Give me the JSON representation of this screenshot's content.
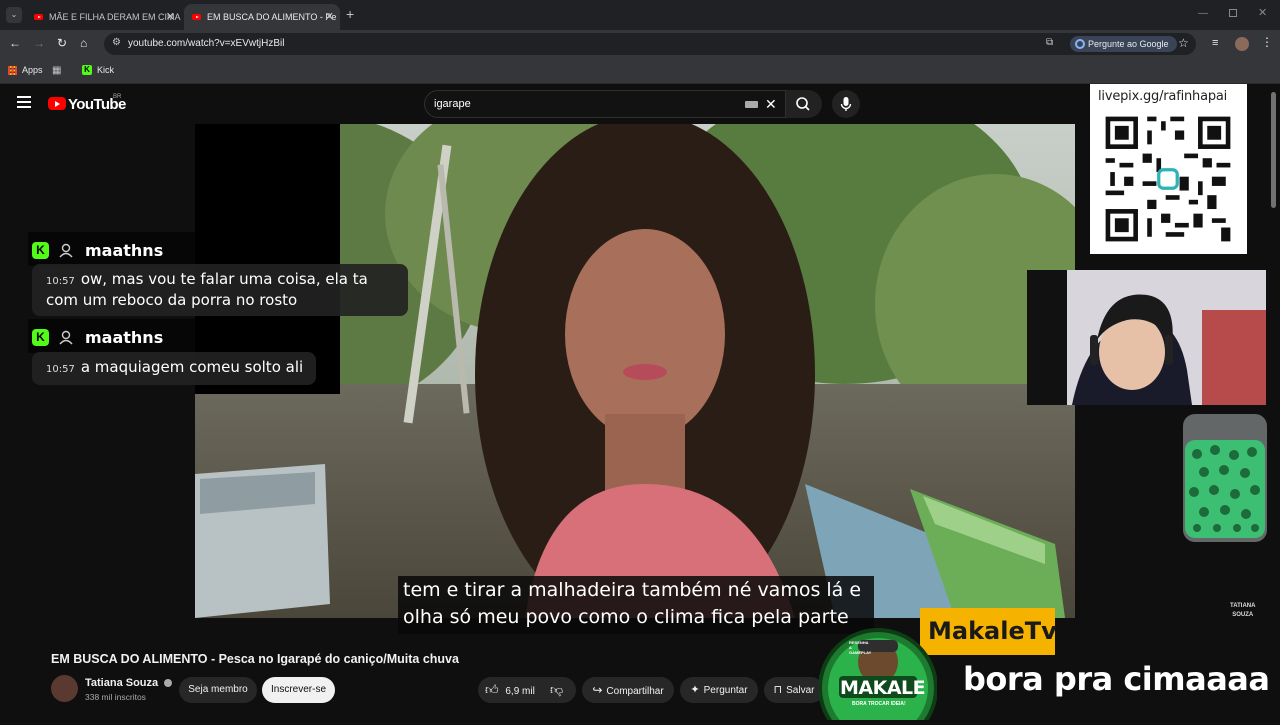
{
  "browser": {
    "tabs": [
      {
        "title": "MÃE E FILHA DERAM EM CIMA",
        "active": false
      },
      {
        "title": "EM BUSCA DO ALIMENTO - Pe",
        "active": true
      }
    ],
    "url": "youtube.com/watch?v=xEVwtjHzBil",
    "ask_google": "Pergunte ao Google",
    "bookmarks": {
      "apps": "Apps",
      "kick": "Kick"
    }
  },
  "youtube": {
    "logo_text": "YouTube",
    "region": "BR",
    "search_value": "igarape"
  },
  "overlay": {
    "qr_label": "livepix.gg/rafinhapai",
    "chat": [
      {
        "user": "maathns",
        "time": "10:57",
        "message": "ow, mas vou te falar uma coisa, ela ta com um reboco da porra no rosto"
      },
      {
        "user": "maathns",
        "time": "10:57",
        "message": "a maquiagem comeu solto ali"
      }
    ],
    "makale_tag": "MakaleTv",
    "bora": "bora pra cimaaaa",
    "badge_top": "RESENHA & GAMEPLAY",
    "badge_name": "MAKALE",
    "badge_bottom": "BORA TROCAR IDEIA!"
  },
  "video": {
    "subtitle_line1": "tem e tirar a malhadeira também né vamos lá e",
    "subtitle_line2": "olha só meu povo como o clima fica pela parte",
    "watermark_line1": "TATIANA",
    "watermark_line2": "SOUZA",
    "title": "EM BUSCA DO ALIMENTO - Pesca no Igarapé do caniço/Muita chuva",
    "channel_name": "Tatiana Souza",
    "subscribers": "338 mil inscritos",
    "join_label": "Seja membro",
    "subscribe_label": "Inscrever-se",
    "likes": "6,9 mil",
    "share_label": "Compartilhar",
    "ask_label": "Perguntar",
    "save_label": "Salvar"
  }
}
